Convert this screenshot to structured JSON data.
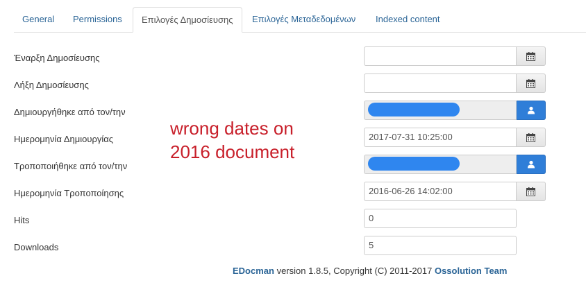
{
  "tabs": [
    {
      "label": "General",
      "active": false
    },
    {
      "label": "Permissions",
      "active": false
    },
    {
      "label": "Επιλογές Δημοσίευσης",
      "active": true
    },
    {
      "label": "Επιλογές Μεταδεδομένων",
      "active": false
    },
    {
      "label": "Indexed content",
      "active": false
    }
  ],
  "form": {
    "publish_up": {
      "label": "Έναρξη Δημοσίευσης",
      "value": "",
      "icon": "calendar-icon"
    },
    "publish_down": {
      "label": "Λήξη Δημοσίευσης",
      "value": "",
      "icon": "calendar-icon"
    },
    "created_by": {
      "label": "Δημιουργήθηκε από τον/την",
      "value": "",
      "icon": "user-icon"
    },
    "created_date": {
      "label": "Ημερομηνία Δημιουργίας",
      "value": "2017-07-31 10:25:00",
      "icon": "calendar-icon"
    },
    "modified_by": {
      "label": "Τροποποιήθηκε από τον/την",
      "value": "",
      "icon": "user-icon"
    },
    "modified_date": {
      "label": "Ημερομηνία Τροποποίησης",
      "value": "2016-06-26 14:02:00",
      "icon": "calendar-icon"
    },
    "hits": {
      "label": "Hits",
      "value": "0"
    },
    "downloads": {
      "label": "Downloads",
      "value": "5"
    }
  },
  "annotation": {
    "line1": "wrong dates on",
    "line2": "2016 document",
    "color": "#c81f2a"
  },
  "footer": {
    "product": "EDocman",
    "text": " version 1.8.5, Copyright (C) 2011-2017 ",
    "author": "Ossolution Team"
  },
  "colors": {
    "link": "#2a6496",
    "primary_button": "#2f7ed8",
    "redaction": "#2f86ef"
  }
}
